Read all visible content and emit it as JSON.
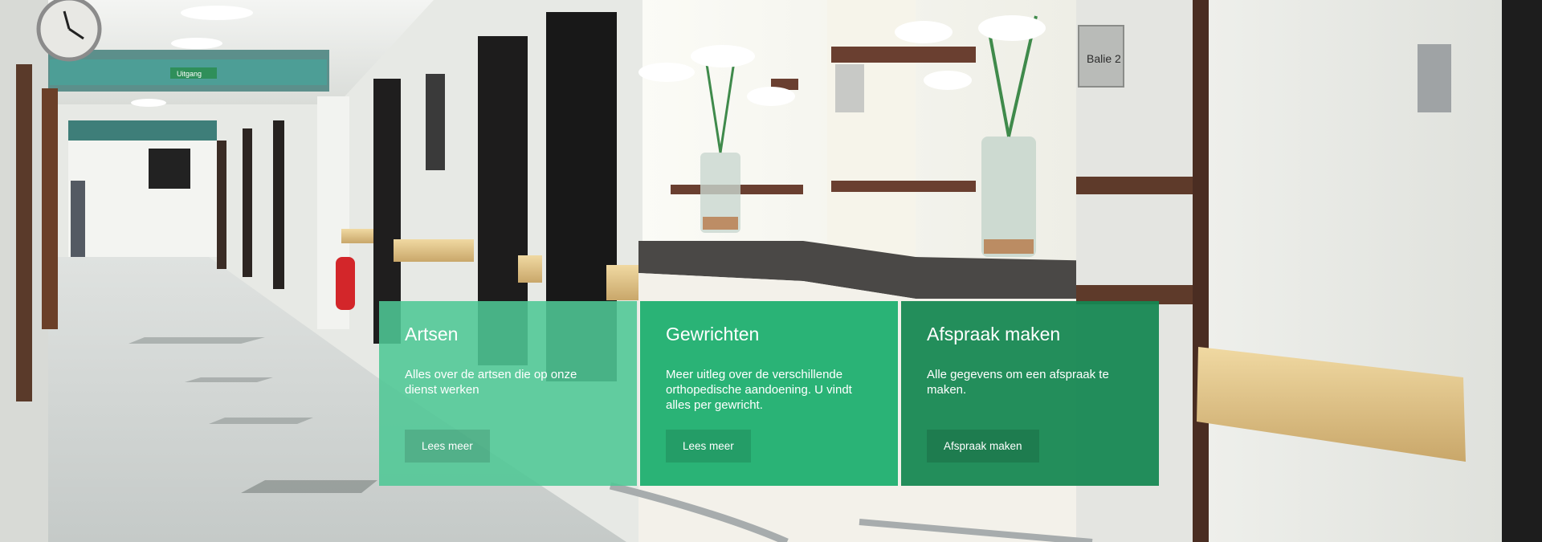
{
  "background": {
    "sign_exit": "Uitgang",
    "sign_desk": "Balie 2"
  },
  "cards": [
    {
      "title": "Artsen",
      "text": "Alles over de artsen die op onze dienst werken",
      "button": "Lees meer",
      "color": "#4ec795"
    },
    {
      "title": "Gewrichten",
      "text": "Meer uitleg over de verschillende orthopedische aandoening. U vindt alles per gewricht.",
      "button": "Lees meer",
      "color": "#1aae6d"
    },
    {
      "title": "Afspraak maken",
      "text": "Alle gegevens om een afspraak te maken.",
      "button": "Afspraak maken",
      "color": "#158752"
    }
  ]
}
